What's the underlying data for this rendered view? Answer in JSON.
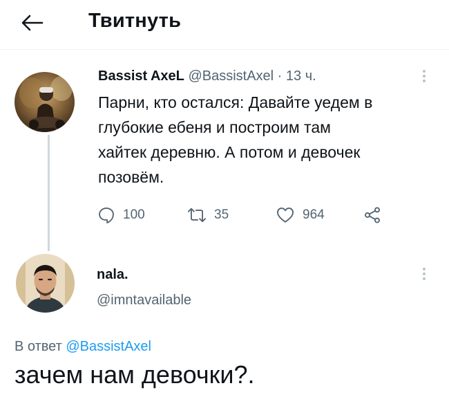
{
  "header": {
    "title": "Твитнуть",
    "back_icon": "arrow-left-icon"
  },
  "tweet": {
    "author_name": "Bassist AxeL",
    "handle": "@BassistAxel",
    "time": "· 13 ч.",
    "text": "Парни, кто остался: Давайте уедем в\nглубокие ебеня и построим там\nхайтек деревню. А потом и девочек\nпозовём.",
    "actions": {
      "replies": "100",
      "retweets": "35",
      "likes": "964"
    }
  },
  "reply": {
    "author_name": "nala.",
    "handle": "@imntavailable",
    "in_reply_prefix": "В ответ",
    "in_reply_handle": "@BassistAxel",
    "text": "зачем нам девочки?."
  },
  "colors": {
    "accent": "#1d9bf0",
    "muted": "#536471",
    "text": "#0f1419",
    "line": "#cfd9de"
  }
}
